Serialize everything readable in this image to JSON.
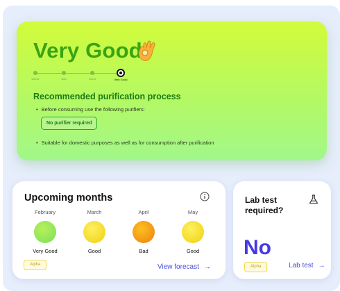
{
  "quality": {
    "title": "Very Good",
    "icon": "ok-hand-icon",
    "steps": [
      "Worse",
      "Bad",
      "Good",
      "Very Good"
    ],
    "active_step": 3,
    "recommendation_title": "Recommended purification process",
    "bullet_1": "Before consuming use the following purifiers:",
    "purifier_pill": "No purifier required",
    "bullet_2": "Suitable for domestic purposes as well as for consumption after purification"
  },
  "upcoming": {
    "title": "Upcoming months",
    "icon": "info-icon",
    "months": [
      {
        "name": "February",
        "rating": "Very Good",
        "color": "#8fe85a"
      },
      {
        "name": "March",
        "rating": "Good",
        "color": "#f7e020"
      },
      {
        "name": "April",
        "rating": "Bad",
        "color": "#f39512"
      },
      {
        "name": "May",
        "rating": "Good",
        "color": "#f7e020"
      }
    ],
    "badge": "Alpha",
    "link": "View forecast",
    "link_icon": "arrow-right-icon"
  },
  "lab": {
    "title": "Lab test required?",
    "icon": "flask-icon",
    "answer": "No",
    "badge": "Alpha",
    "link": "Lab test",
    "link_icon": "arrow-right-icon"
  },
  "colors": {
    "hero_gradient_top": "#d2fb3a",
    "hero_gradient_bottom": "#a1f78a",
    "title_green": "#3aa313",
    "accent_blue": "#4a4ee0",
    "answer_blue": "#4838e6"
  }
}
